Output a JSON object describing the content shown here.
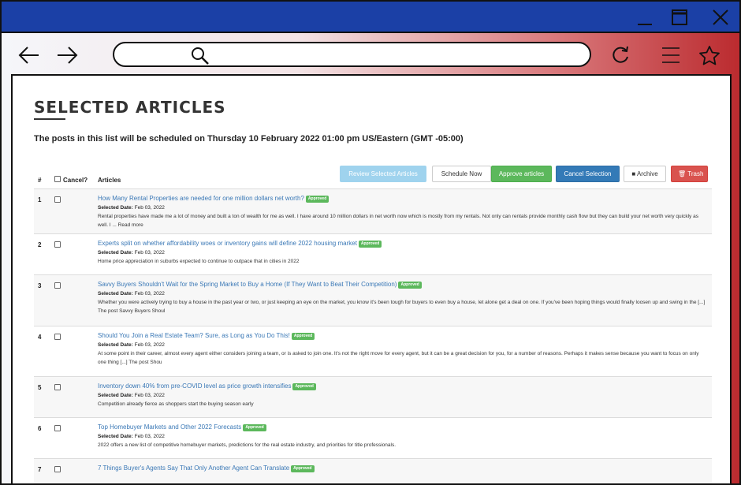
{
  "page": {
    "title": "SELECTED ARTICLES",
    "subtitle": "The posts in this list will be scheduled on Thursday 10 February 2022 01:00 pm US/Eastern (GMT -05:00)"
  },
  "table": {
    "headers": {
      "num": "#",
      "cancel": "Cancel?",
      "articles": "Articles"
    },
    "buttons": {
      "review": "Review Selected Articles",
      "schedule": "Schedule Now",
      "approve": "Approve articles",
      "cancel": "Cancel Selection",
      "archive": "Archive",
      "trash": "Trash"
    },
    "date_label": "Selected Date:",
    "rows": [
      {
        "num": "1",
        "title": "How Many Rental Properties are needed for one million dollars net worth?",
        "status": "Approved",
        "date": "Feb 03, 2022",
        "excerpt": "Rental properties have made me a lot of money and built a ton of wealth for me as well. I have around 10 million dollars in net worth now which is mostly from my rentals. Not only can rentals provide monthly cash flow but they can build your net worth very quickly as well. I ... Read more"
      },
      {
        "num": "2",
        "title": "Experts split on whether affordability woes or inventory gains will define 2022 housing market",
        "status": "Approved",
        "date": "Feb 03, 2022",
        "excerpt": "Home price appreciation in suburbs expected to continue to outpace that in cities in 2022"
      },
      {
        "num": "3",
        "title": "Savvy Buyers Shouldn't Wait for the Spring Market to Buy a Home (If They Want to Beat Their Competition)",
        "status": "Approved",
        "date": "Feb 03, 2022",
        "excerpt": "Whether you were actively trying to buy a house in the past year or two, or just keeping an eye on the market, you know it's been tough for buyers to even buy a house, let alone get a deal on one. If you've been hoping things would finally loosen up and swing in the [...] The post Savvy Buyers Shoul"
      },
      {
        "num": "4",
        "title": "Should You Join a Real Estate Team? Sure, as Long as You Do This!",
        "status": "Approved",
        "date": "Feb 03, 2022",
        "excerpt": "At some point in their career, almost every agent either considers joining a team, or is asked to join one. It's not the right move for every agent, but it can be a great decision for you, for a number of reasons. Perhaps it makes sense because you want to focus on only one thing [...] The post Shou"
      },
      {
        "num": "5",
        "title": "Inventory down 40% from pre-COVID level as price growth intensifies",
        "status": "Approved",
        "date": "Feb 03, 2022",
        "excerpt": "Competition already fierce as shoppers start the buying season early"
      },
      {
        "num": "6",
        "title": "Top Homebuyer Markets and Other 2022 Forecasts",
        "status": "Approved",
        "date": "Feb 03, 2022",
        "excerpt": "2022 offers a new list of competitive homebuyer markets, predictions for the real estate industry, and priorities for title professionals."
      },
      {
        "num": "7",
        "title": "7 Things Buyer's Agents Say That Only Another Agent Can Translate",
        "status": "Approved",
        "date": "",
        "excerpt": ""
      }
    ]
  },
  "colors": {
    "titlebar": "#1b40a6",
    "link": "#3a78b6",
    "approved": "#5cb85c",
    "primary": "#337ab7",
    "danger": "#d9534f",
    "info": "#9fd3ee"
  }
}
